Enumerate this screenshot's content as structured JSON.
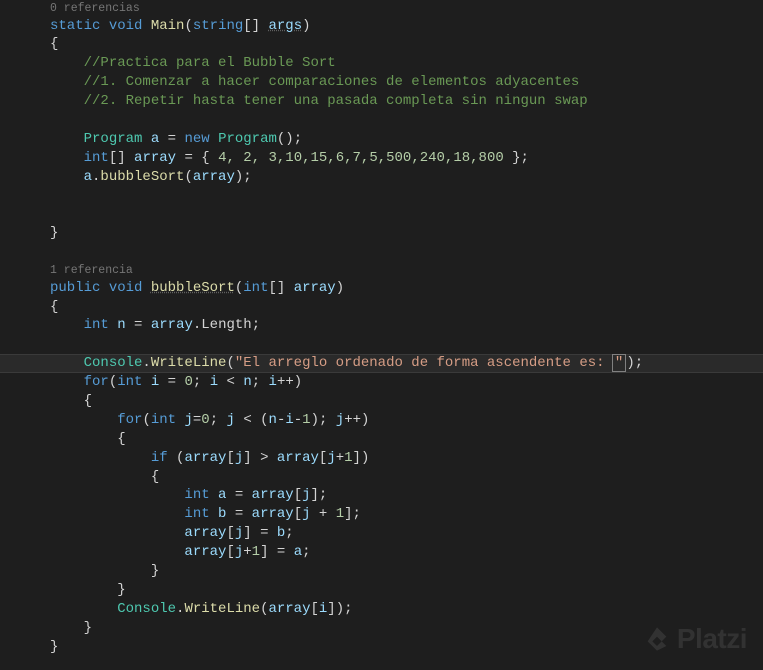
{
  "codelens": {
    "main": "0 referencias",
    "bubbleSort": "1 referencia"
  },
  "code": {
    "main_decl": {
      "kw1": "static",
      "kw2": "void",
      "name": "Main",
      "ptype": "string",
      "brackets": "[]",
      "pname": "args"
    },
    "comments": {
      "c1": "//Practica para el Bubble Sort",
      "c2": "//1. Comenzar a hacer comparaciones de elementos adyacentes",
      "c3": "//2. Repetir hasta tener una pasada completa sin ningun swap"
    },
    "inst": {
      "type": "Program",
      "var": "a",
      "eq": "=",
      "new": "new",
      "ctor": "Program",
      "tail": "();"
    },
    "arr_decl": {
      "type": "int",
      "brackets": "[]",
      "name": "array",
      "eq": "=",
      "open": "{ ",
      "vals": "4, 2, 3,10,15,6,7,5,500,240,18,800",
      "close": " };"
    },
    "call": {
      "obj": "a",
      "dot": ".",
      "fn": "bubbleSort",
      "open": "(",
      "arg": "array",
      "close": ");"
    },
    "bs_decl": {
      "kw1": "public",
      "kw2": "void",
      "name": "bubbleSort",
      "ptype": "int",
      "brackets": "[]",
      "pname": "array"
    },
    "n_decl": {
      "type": "int",
      "var": "n",
      "eq": "=",
      "obj": "array",
      "dot": ".",
      "prop": "Length",
      "semi": ";"
    },
    "writeln1": {
      "cls": "Console",
      "dot": ".",
      "fn": "WriteLine",
      "open": "(",
      "str": "\"El arreglo ordenado de forma ascendente es: ",
      "close_q": "\"",
      "close": ");"
    },
    "for_outer": {
      "kw": "for",
      "open": "(",
      "type": "int",
      "var": "i",
      "eq": "=",
      "zero": "0",
      "semi": ";",
      "cond_l": "i",
      "lt": "<",
      "cond_r": "n",
      "inc": "i",
      "pp": "++",
      "close": ")"
    },
    "for_inner": {
      "kw": "for",
      "open": "(",
      "type": "int",
      "var": "j",
      "eq": "=",
      "zero": "0",
      "semi": ";",
      "cond_l": "j",
      "lt": "<",
      "paren_o": "(",
      "n": "n",
      "m": "-",
      "i": "i",
      "m2": "-",
      "one": "1",
      "paren_c": ")",
      "inc": "j",
      "pp": "++",
      "close": ")"
    },
    "if_stmt": {
      "kw": "if",
      "open": "(",
      "arr1": "array",
      "bo1": "[",
      "j1": "j",
      "bc1": "]",
      "gt": ">",
      "arr2": "array",
      "bo2": "[",
      "j2": "j",
      "plus": "+",
      "one": "1",
      "bc2": "]",
      "close": ")"
    },
    "a_decl": {
      "type": "int",
      "var": "a",
      "eq": "=",
      "arr": "array",
      "bo": "[",
      "idx": "j",
      "bc": "];"
    },
    "b_decl": {
      "type": "int",
      "var": "b",
      "eq": "=",
      "arr": "array",
      "bo": "[",
      "j": "j",
      "plus": "+",
      "one": "1",
      "bc": "];"
    },
    "swap1": {
      "arr": "array",
      "bo": "[",
      "idx": "j",
      "bc": "]",
      "eq": "=",
      "val": "b",
      "semi": ";"
    },
    "swap2": {
      "arr": "array",
      "bo": "[",
      "j": "j",
      "plus": "+",
      "one": "1",
      "bc": "]",
      "eq": "=",
      "val": "a",
      "semi": ";"
    },
    "writeln2": {
      "cls": "Console",
      "dot": ".",
      "fn": "WriteLine",
      "open": "(",
      "arr": "array",
      "bo": "[",
      "idx": "i",
      "bc": "]",
      "close": ");"
    },
    "braces": {
      "open": "{",
      "close": "}"
    }
  },
  "watermark": "Platzi"
}
